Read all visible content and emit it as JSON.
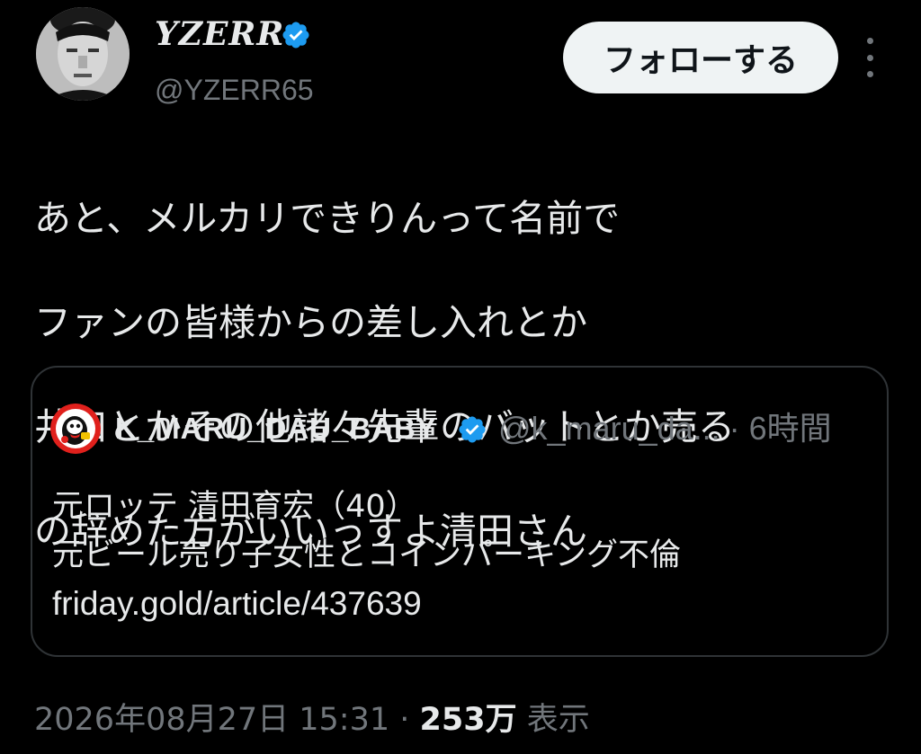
{
  "author": {
    "display_name": "YZERR",
    "handle": "@YZERR65",
    "verified": true,
    "avatar_icon": "grayscale-portrait-avatar"
  },
  "actions": {
    "follow_label": "フォローする",
    "more_icon": "vertical-ellipsis-icon"
  },
  "tweet": {
    "lines": [
      "あと、メルカリできりんって名前で",
      "ファンの皆様からの差し入れとか",
      "井口とかその他諸々先輩のバットとか売る",
      "の辞めた方がいいっすよ清田さん"
    ]
  },
  "quote": {
    "display_name": "K_MARU_DAU_BABY",
    "verified": true,
    "handle_time": "@k_maru_da... · 6時間",
    "lines": [
      "元ロッテ 清田育宏（40）",
      "元ビール売り子女性とコインパーキング不倫"
    ],
    "link": "friday.gold/article/437639",
    "avatar_icon": "cartoon-mascot-avatar"
  },
  "meta": {
    "timestamp": "2026年08月27日 15:31",
    "separator": " · ",
    "views_count": "253万",
    "views_label": " 表示"
  },
  "colors": {
    "background": "#000000",
    "text_primary": "#e7e9ea",
    "text_secondary": "#71767b",
    "verified_blue": "#1d9bf0",
    "border": "#2f3336",
    "follow_button_bg": "#eff3f4"
  }
}
